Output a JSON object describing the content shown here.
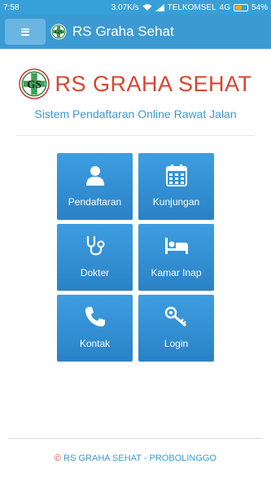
{
  "status_bar": {
    "time": "7:58",
    "network_speed": "3.07K/s",
    "carrier": "TELKOMSEL",
    "network_type": "4G",
    "battery": "54%",
    "battery_level": 0.54
  },
  "app_bar": {
    "title": "RS Graha Sehat",
    "menu_icon": "hamburger-icon"
  },
  "header": {
    "title": "RS GRAHA SEHAT",
    "subtitle": "Sistem Pendaftaran Online Rawat Jalan",
    "logo_icon": "hospital-logo-icon"
  },
  "menu": [
    {
      "key": "pendaftaran",
      "label": "Pendaftaran",
      "icon": "user-icon"
    },
    {
      "key": "kunjungan",
      "label": "Kunjungan",
      "icon": "calendar-icon"
    },
    {
      "key": "dokter",
      "label": "Dokter",
      "icon": "stethoscope-icon"
    },
    {
      "key": "kamar-inap",
      "label": "Kamar Inap",
      "icon": "bed-icon"
    },
    {
      "key": "kontak",
      "label": "Kontak",
      "icon": "phone-icon"
    },
    {
      "key": "login",
      "label": "Login",
      "icon": "key-icon"
    }
  ],
  "footer": {
    "copyright_symbol": "©",
    "text": "RS GRAHA SEHAT - PROBOLINGGO"
  },
  "colors": {
    "primary": "#3c9ad3",
    "brand_red": "#d8452f",
    "tile": "#2f8fd6"
  }
}
